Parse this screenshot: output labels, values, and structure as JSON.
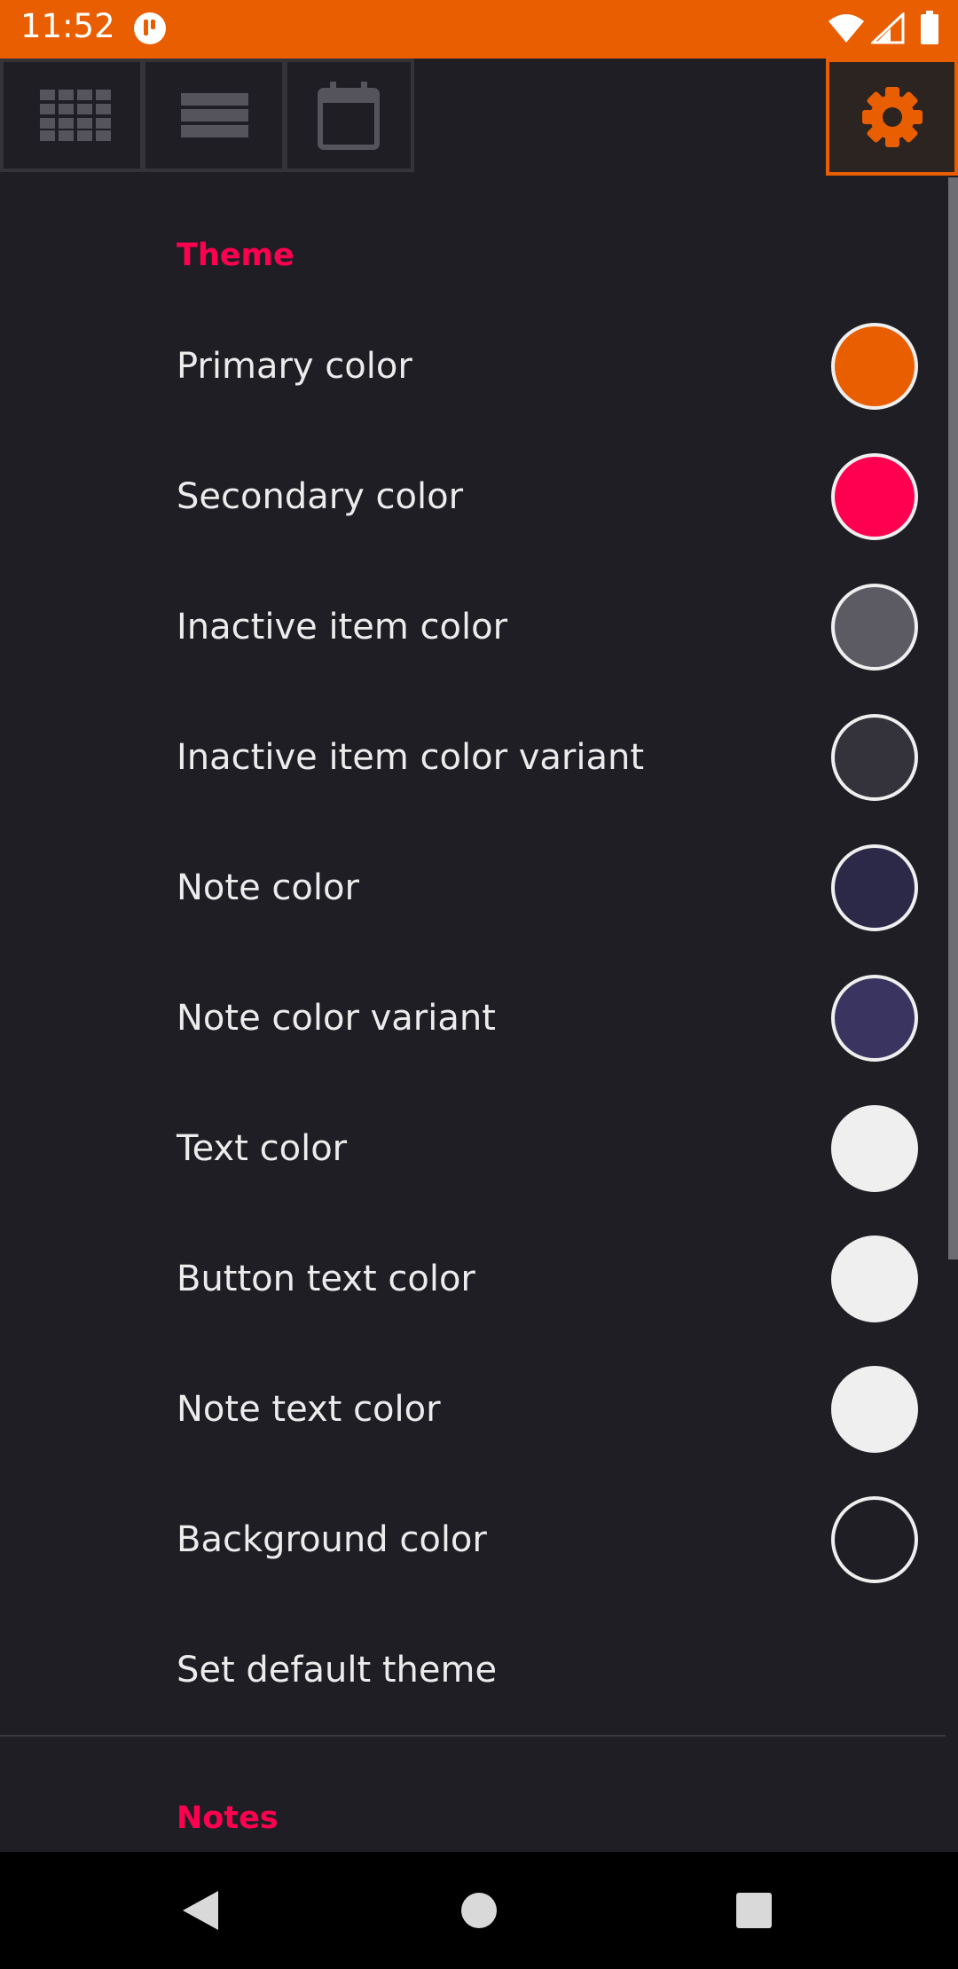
{
  "status_bar": {
    "time": "11:52",
    "app_icon": "notification-app-icon",
    "icons": [
      "wifi-icon",
      "signal-icon",
      "battery-icon"
    ],
    "background": "#e95e00"
  },
  "toolbar": {
    "tabs": [
      {
        "name": "grid-view",
        "icon": "grid-icon",
        "selected": false
      },
      {
        "name": "list-view",
        "icon": "list-icon",
        "selected": false
      },
      {
        "name": "calendar-view",
        "icon": "calendar-icon",
        "selected": false
      },
      {
        "name": "settings",
        "icon": "gear-icon",
        "selected": true
      }
    ],
    "accent": "#e95e00"
  },
  "theme_section": {
    "title": "Theme",
    "items": [
      {
        "label": "Primary color",
        "color": "#e95e00"
      },
      {
        "label": "Secondary color",
        "color": "#ff0050"
      },
      {
        "label": "Inactive item color",
        "color": "#5c5b64"
      },
      {
        "label": "Inactive item color variant",
        "color": "#34333b"
      },
      {
        "label": "Note color",
        "color": "#2b2848"
      },
      {
        "label": "Note color variant",
        "color": "#393560"
      },
      {
        "label": "Text color",
        "color": "#efefef"
      },
      {
        "label": "Button text color",
        "color": "#efefef"
      },
      {
        "label": "Note text color",
        "color": "#efefef"
      },
      {
        "label": "Background color",
        "color": "#1f1e24"
      }
    ],
    "default_action": "Set default theme"
  },
  "notes_section": {
    "title": "Notes"
  },
  "nav_bar": {
    "buttons": [
      "back-icon",
      "home-icon",
      "recents-icon"
    ]
  }
}
